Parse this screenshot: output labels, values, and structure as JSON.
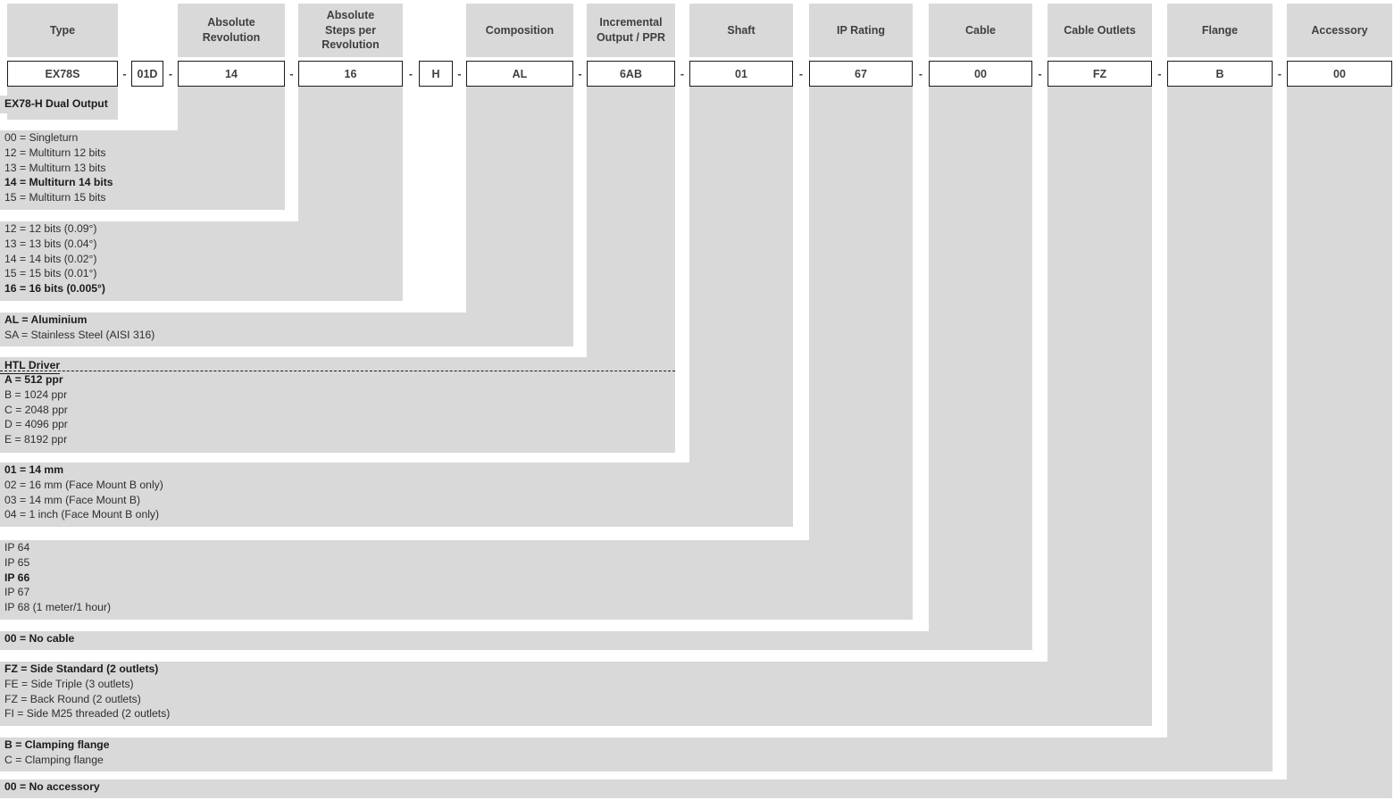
{
  "columns": [
    {
      "key": "type",
      "header": "Type",
      "value": "EX78S"
    },
    {
      "key": "type_sub",
      "header": "",
      "value": "01D"
    },
    {
      "key": "abs_rev",
      "header": "Absolute Revolution",
      "value": "14"
    },
    {
      "key": "abs_steps",
      "header": "Absolute\nSteps per\nRevolution",
      "value": "16"
    },
    {
      "key": "driver",
      "header": "",
      "value": "H"
    },
    {
      "key": "composition",
      "header": "Composition",
      "value": "AL"
    },
    {
      "key": "incremental",
      "header": "Incremental\nOutput / PPR",
      "value": "6AB"
    },
    {
      "key": "shaft",
      "header": "Shaft",
      "value": "01"
    },
    {
      "key": "ip_rating",
      "header": "IP Rating",
      "value": "67"
    },
    {
      "key": "cable",
      "header": "Cable",
      "value": "00"
    },
    {
      "key": "cable_outlets",
      "header": "Cable Outlets",
      "value": "FZ"
    },
    {
      "key": "flange",
      "header": "Flange",
      "value": "B"
    },
    {
      "key": "accessory",
      "header": "Accessory",
      "value": "00"
    }
  ],
  "separator": "-",
  "type_label": "EX78-H Dual Output",
  "option_blocks": {
    "abs_rev": {
      "lines": [
        {
          "text": "00 = Singleturn",
          "bold": false
        },
        {
          "text": "12 = Multiturn 12 bits",
          "bold": false
        },
        {
          "text": "13 = Multiturn 13 bits",
          "bold": false
        },
        {
          "text": "14 = Multiturn 14 bits",
          "bold": true
        },
        {
          "text": "15 = Multiturn 15 bits",
          "bold": false
        }
      ]
    },
    "abs_steps": {
      "lines": [
        {
          "text": "12 = 12 bits (0.09°)",
          "bold": false
        },
        {
          "text": "13 = 13 bits (0.04°)",
          "bold": false
        },
        {
          "text": "14 = 14 bits (0.02°)",
          "bold": false
        },
        {
          "text": "15 = 15 bits (0.01°)",
          "bold": false
        },
        {
          "text": "16 = 16 bits (0.005°)",
          "bold": true
        }
      ]
    },
    "composition": {
      "lines": [
        {
          "text": "AL = Aluminium",
          "bold": true
        },
        {
          "text": "SA = Stainless Steel (AISI 316)",
          "bold": false
        }
      ]
    },
    "incremental": {
      "group_title": "HTL Driver",
      "lines": [
        {
          "text": "A = 512 ppr",
          "bold": true
        },
        {
          "text": "B = 1024 ppr",
          "bold": false
        },
        {
          "text": "C = 2048 ppr",
          "bold": false
        },
        {
          "text": "D = 4096 ppr",
          "bold": false
        },
        {
          "text": "E = 8192 ppr",
          "bold": false
        }
      ]
    },
    "shaft": {
      "lines": [
        {
          "text": "01 = 14 mm",
          "bold": true
        },
        {
          "text": "02 = 16 mm (Face Mount B only)",
          "bold": false
        },
        {
          "text": "03 = 14 mm (Face Mount B)",
          "bold": false
        },
        {
          "text": "04 = 1 inch (Face Mount B only)",
          "bold": false
        }
      ]
    },
    "ip_rating": {
      "lines": [
        {
          "text": "IP 64",
          "bold": false
        },
        {
          "text": "IP 65",
          "bold": false
        },
        {
          "text": "IP 66",
          "bold": true
        },
        {
          "text": "IP 67",
          "bold": false
        },
        {
          "text": "IP 68 (1 meter/1 hour)",
          "bold": false
        }
      ]
    },
    "cable": {
      "lines": [
        {
          "text": "00 = No cable",
          "bold": true
        }
      ]
    },
    "cable_outlets": {
      "lines": [
        {
          "text": "FZ = Side Standard (2 outlets)",
          "bold": true
        },
        {
          "text": "FE = Side Triple (3 outlets)",
          "bold": false
        },
        {
          "text": "FZ = Back Round (2 outlets)",
          "bold": false
        },
        {
          "text": "FI = Side M25 threaded (2 outlets)",
          "bold": false
        }
      ]
    },
    "flange": {
      "lines": [
        {
          "text": "B = Clamping flange",
          "bold": true
        },
        {
          "text": "C = Clamping flange",
          "bold": false
        }
      ]
    },
    "accessory": {
      "lines": [
        {
          "text": "00 = No accessory",
          "bold": true
        }
      ]
    }
  },
  "colors": {
    "band": "#d9d9d9",
    "box_border": "#1a1a1a",
    "text": "#3f3f3f",
    "background": "#ffffff"
  }
}
